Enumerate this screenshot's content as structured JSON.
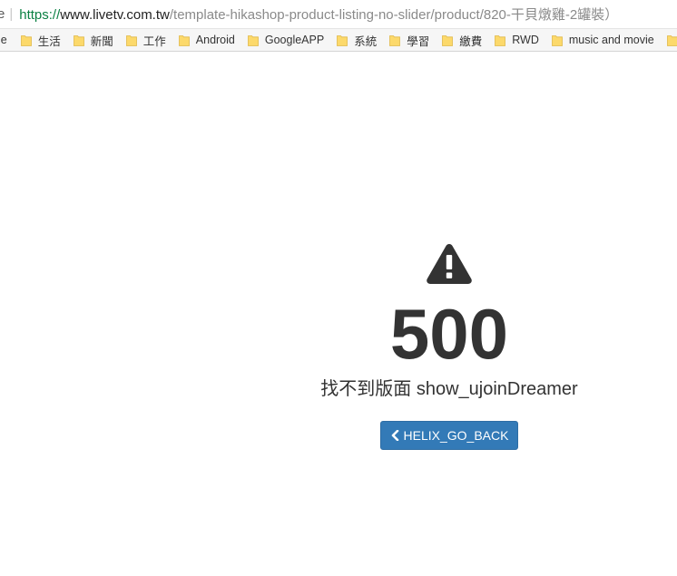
{
  "browser": {
    "address_prefix": "e",
    "url": {
      "scheme": "https://",
      "host": "www.livetv.com.tw",
      "path": "/template-hikashop-product-listing-no-slider/product/820-干貝燉雞-2罐裝）"
    },
    "bookmarks_cut_label": "le",
    "bookmarks": [
      {
        "label": "生活",
        "icon": "folder-icon"
      },
      {
        "label": "新聞",
        "icon": "folder-icon"
      },
      {
        "label": "工作",
        "icon": "folder-icon"
      },
      {
        "label": "Android",
        "icon": "folder-icon"
      },
      {
        "label": "GoogleAPP",
        "icon": "folder-icon"
      },
      {
        "label": "系統",
        "icon": "folder-icon"
      },
      {
        "label": "學習",
        "icon": "folder-icon"
      },
      {
        "label": "繳費",
        "icon": "folder-icon"
      },
      {
        "label": "RWD",
        "icon": "folder-icon"
      },
      {
        "label": "music and movie",
        "icon": "folder-icon"
      },
      {
        "label": "",
        "icon": "folder-icon"
      }
    ]
  },
  "error_page": {
    "icon": "warning-icon",
    "code": "500",
    "message": "找不到版面 show_ujoinDreamer",
    "back_button_label": "HELIX_GO_BACK",
    "back_button_icon": "chevron-left-icon"
  },
  "colors": {
    "button_bg": "#337ab7",
    "text_dark": "#333333",
    "folder_yellow": "#fcd96b",
    "https_green": "#0b8043"
  }
}
